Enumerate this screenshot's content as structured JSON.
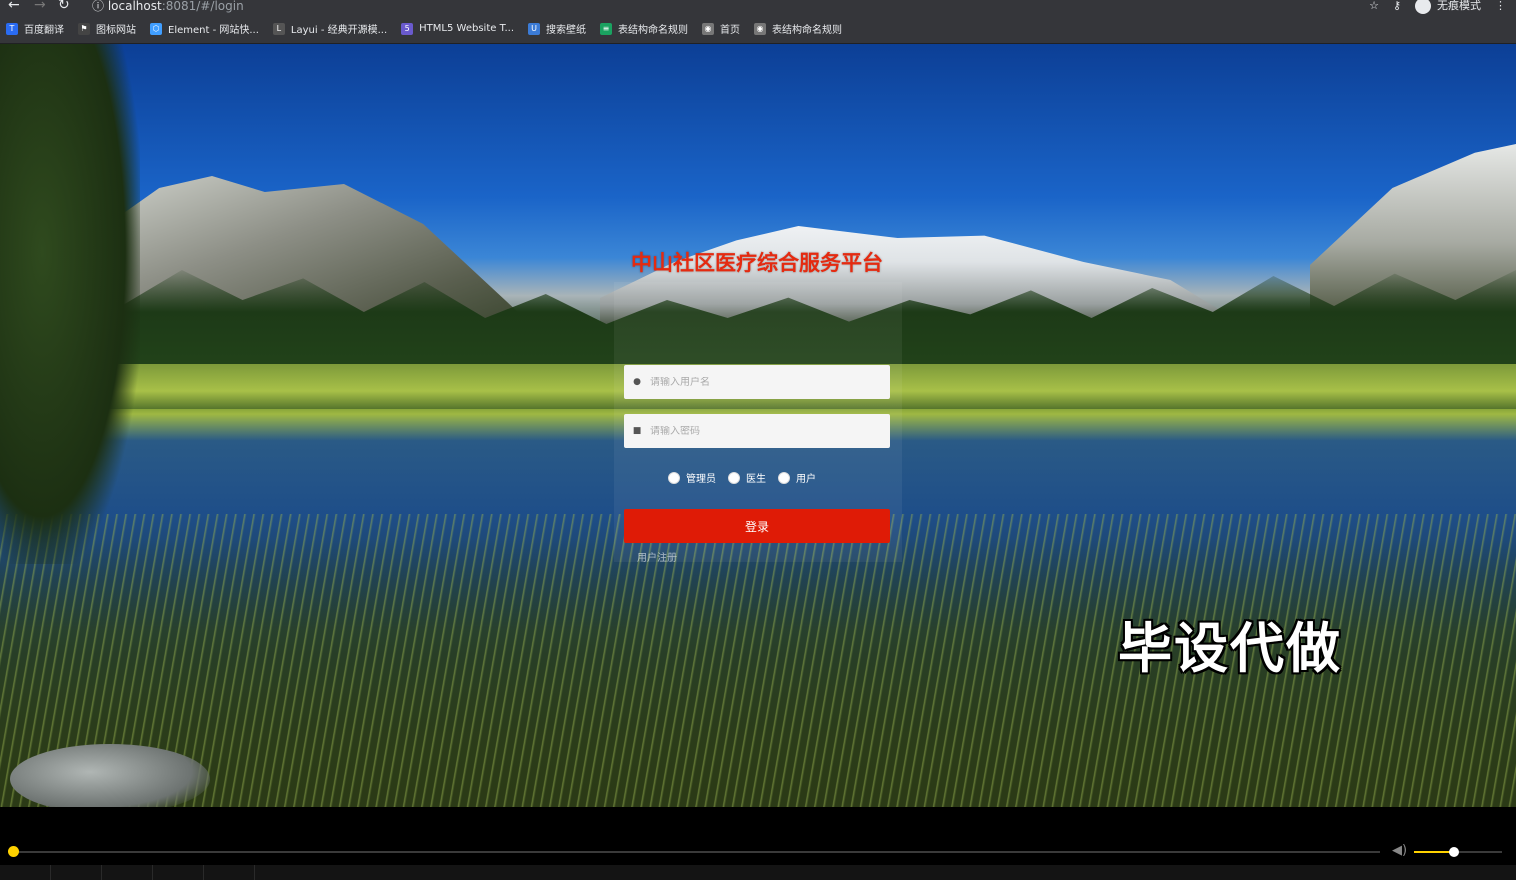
{
  "browser": {
    "url_host": "localhost",
    "url_path": ":8081/#/login",
    "incognito_label": "无痕模式"
  },
  "bookmarks": [
    {
      "label": "百度翻译",
      "icon": "translate-icon",
      "color": "#2a6bf2"
    },
    {
      "label": "图标网站",
      "icon": "flag-icon",
      "color": "#444444"
    },
    {
      "label": "Element - 网站快...",
      "icon": "element-icon",
      "color": "#409eff"
    },
    {
      "label": "Layui - 经典开源模...",
      "icon": "layui-icon",
      "color": "#555555"
    },
    {
      "label": "HTML5 Website T...",
      "icon": "html5-icon",
      "color": "#6a5acd"
    },
    {
      "label": "搜索壁纸",
      "icon": "wallpaper-icon",
      "color": "#3b7bd6"
    },
    {
      "label": "表结构命名规则",
      "icon": "table-icon",
      "color": "#1aa260"
    },
    {
      "label": "首页",
      "icon": "globe-icon",
      "color": "#777777"
    },
    {
      "label": "表结构命名规则",
      "icon": "globe-icon",
      "color": "#777777"
    }
  ],
  "login": {
    "title": "中山社区医疗综合服务平台",
    "username_placeholder": "请输入用户名",
    "password_placeholder": "请输入密码",
    "roles": [
      "管理员",
      "医生",
      "用户"
    ],
    "submit_label": "登录",
    "register_label": "用户注册",
    "accent_color": "#df1b06"
  },
  "watermark": "毕设代做",
  "player": {
    "progress": 0.0,
    "volume": 0.45
  }
}
